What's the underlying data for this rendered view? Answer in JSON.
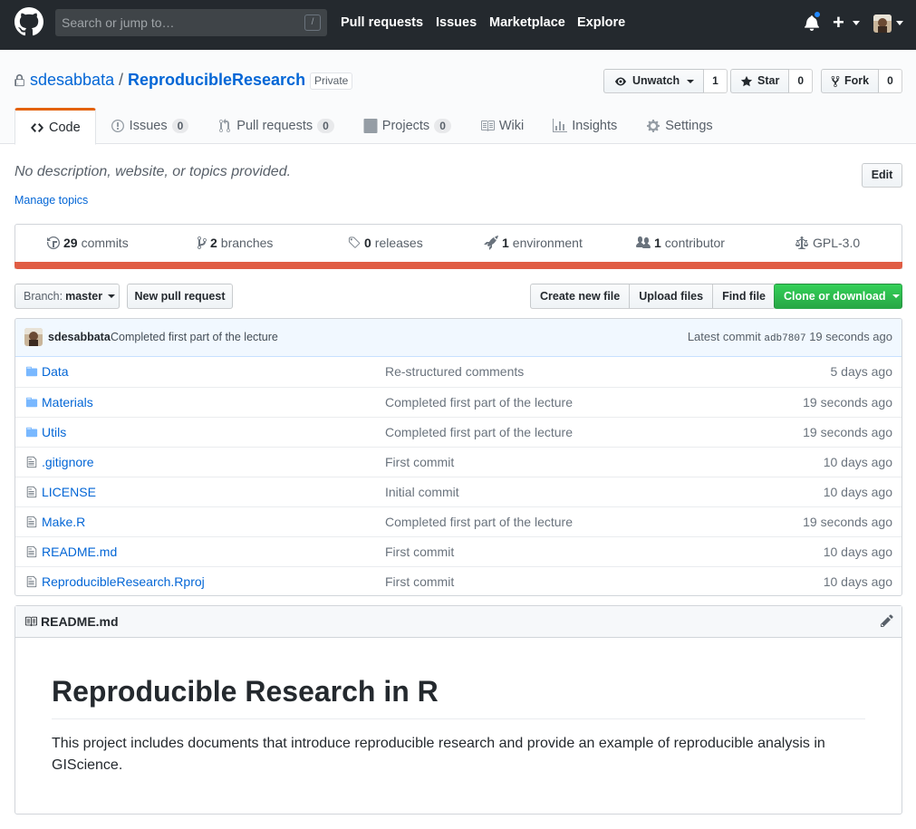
{
  "header": {
    "search_placeholder": "Search or jump to…",
    "search_key": "/",
    "nav": [
      "Pull requests",
      "Issues",
      "Marketplace",
      "Explore"
    ]
  },
  "repo": {
    "owner": "sdesabbata",
    "separator": "/",
    "name": "ReproducibleResearch",
    "visibility": "Private",
    "watch_label": "Unwatch",
    "watch_count": "1",
    "star_label": "Star",
    "star_count": "0",
    "fork_label": "Fork",
    "fork_count": "0"
  },
  "tabs": [
    {
      "label": "Code",
      "counter": null,
      "icon": "code-icon"
    },
    {
      "label": "Issues",
      "counter": "0",
      "icon": "issue-icon"
    },
    {
      "label": "Pull requests",
      "counter": "0",
      "icon": "pull-request-icon"
    },
    {
      "label": "Projects",
      "counter": "0",
      "icon": "project-icon"
    },
    {
      "label": "Wiki",
      "counter": null,
      "icon": "book-icon"
    },
    {
      "label": "Insights",
      "counter": null,
      "icon": "graph-icon"
    },
    {
      "label": "Settings",
      "counter": null,
      "icon": "gear-icon"
    }
  ],
  "description": {
    "text": "No description, website, or topics provided.",
    "manage_topics": "Manage topics",
    "edit_label": "Edit"
  },
  "summary": {
    "commits_count": "29",
    "commits_label": "commits",
    "branches_count": "2",
    "branches_label": "branches",
    "releases_count": "0",
    "releases_label": "releases",
    "environment_count": "1",
    "environment_label": "environment",
    "contributor_count": "1",
    "contributor_label": "contributor",
    "license": "GPL-3.0",
    "language_color": "#e05d44"
  },
  "filenav": {
    "branch_prefix": "Branch:",
    "branch_name": "master",
    "new_pr": "New pull request",
    "create_file": "Create new file",
    "upload_files": "Upload files",
    "find_file": "Find file",
    "clone": "Clone or download"
  },
  "commit": {
    "author": "sdesabbata",
    "message": "Completed first part of the lecture",
    "latest_label": "Latest commit",
    "sha": "adb7807",
    "time": "19 seconds ago"
  },
  "files": [
    {
      "type": "dir",
      "name": "Data",
      "message": "Re-structured comments",
      "age": "5 days ago"
    },
    {
      "type": "dir",
      "name": "Materials",
      "message": "Completed first part of the lecture",
      "age": "19 seconds ago"
    },
    {
      "type": "dir",
      "name": "Utils",
      "message": "Completed first part of the lecture",
      "age": "19 seconds ago"
    },
    {
      "type": "file",
      "name": ".gitignore",
      "message": "First commit",
      "age": "10 days ago"
    },
    {
      "type": "file",
      "name": "LICENSE",
      "message": "Initial commit",
      "age": "10 days ago"
    },
    {
      "type": "file",
      "name": "Make.R",
      "message": "Completed first part of the lecture",
      "age": "19 seconds ago"
    },
    {
      "type": "file",
      "name": "README.md",
      "message": "First commit",
      "age": "10 days ago"
    },
    {
      "type": "file",
      "name": "ReproducibleResearch.Rproj",
      "message": "First commit",
      "age": "10 days ago"
    }
  ],
  "readme": {
    "filename": "README.md",
    "title": "Reproducible Research in R",
    "body": "This project includes documents that introduce reproducible research and provide an example of reproducible analysis in GIScience."
  }
}
